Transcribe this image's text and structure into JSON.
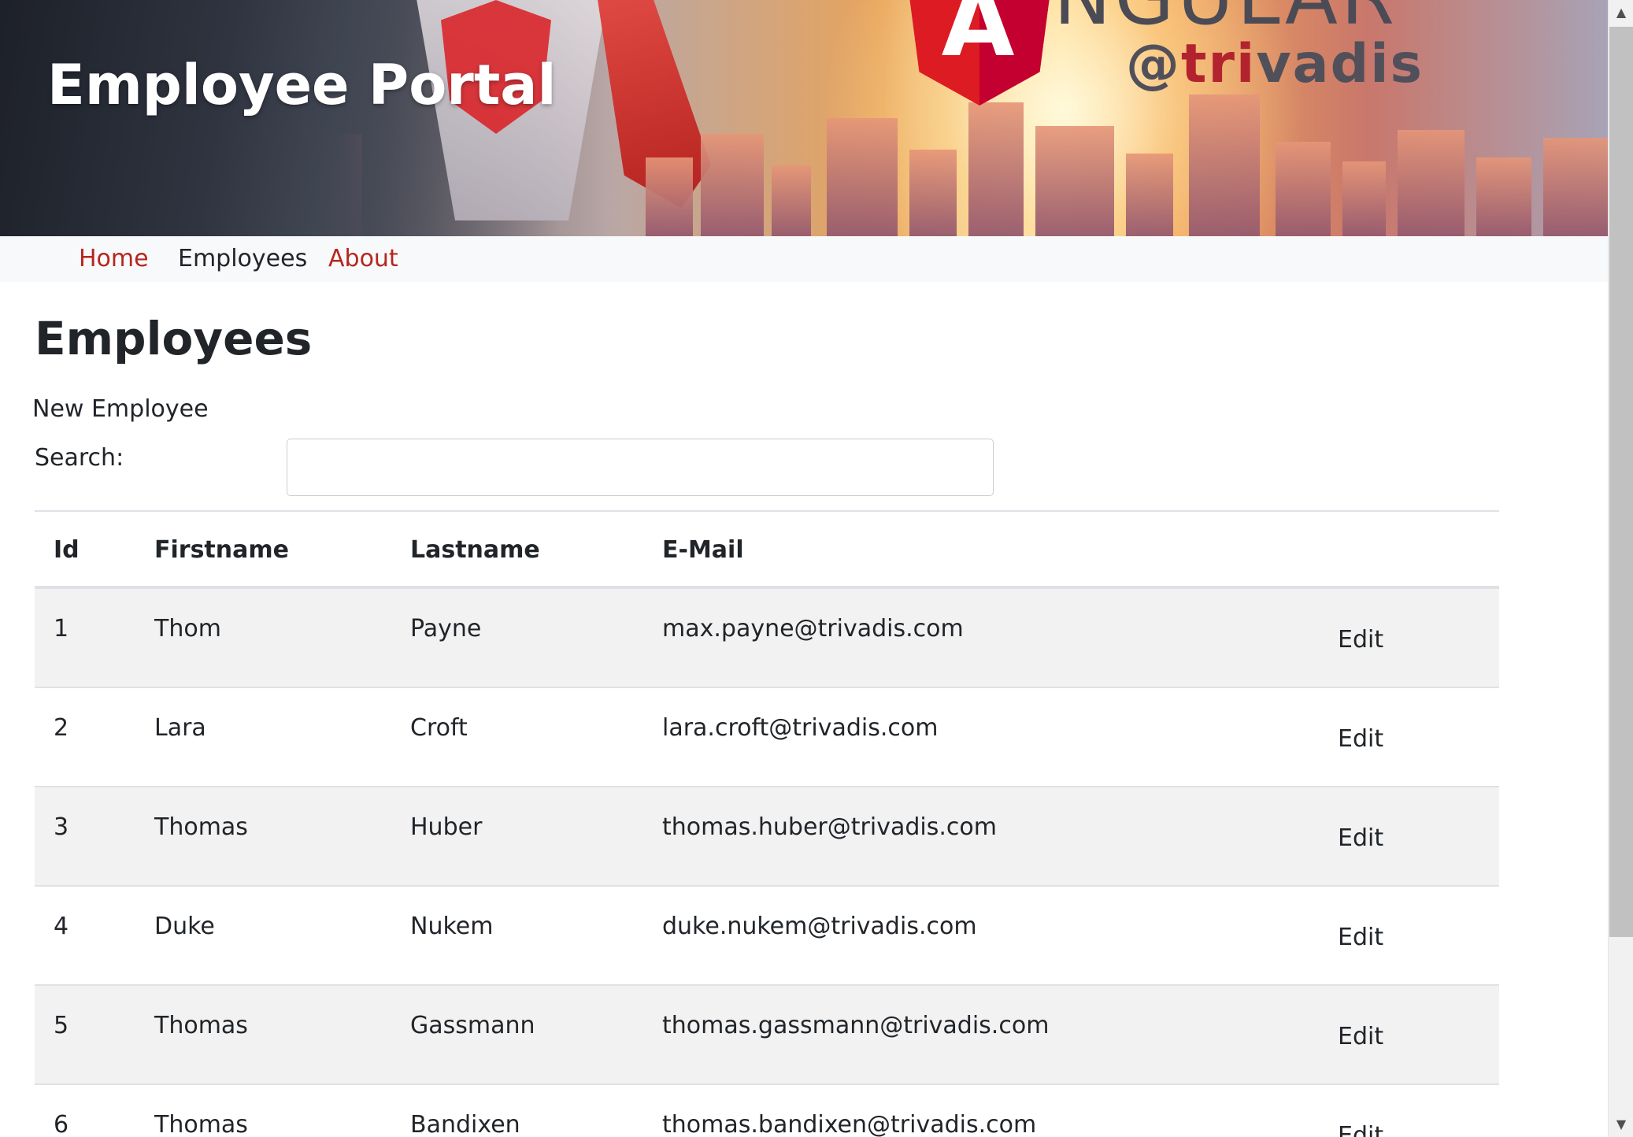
{
  "banner": {
    "title": "Employee Portal",
    "logo_word": "NGULAR",
    "logo_letter": "A",
    "brand_prefix": "@",
    "brand_accent": "tri",
    "brand_suffix": "vadis"
  },
  "nav": {
    "items": [
      {
        "label": "Home",
        "active": false
      },
      {
        "label": "Employees",
        "active": true
      },
      {
        "label": "About",
        "active": false
      }
    ]
  },
  "main": {
    "title": "Employees",
    "new_employee_label": "New Employee",
    "search_label": "Search:",
    "search_value": "",
    "table": {
      "headers": {
        "id": "Id",
        "firstname": "Firstname",
        "lastname": "Lastname",
        "email": "E-Mail"
      },
      "edit_label": "Edit",
      "rows": [
        {
          "id": "1",
          "firstname": "Thom",
          "lastname": "Payne",
          "email": "max.payne@trivadis.com"
        },
        {
          "id": "2",
          "firstname": "Lara",
          "lastname": "Croft",
          "email": "lara.croft@trivadis.com"
        },
        {
          "id": "3",
          "firstname": "Thomas",
          "lastname": "Huber",
          "email": "thomas.huber@trivadis.com"
        },
        {
          "id": "4",
          "firstname": "Duke",
          "lastname": "Nukem",
          "email": "duke.nukem@trivadis.com"
        },
        {
          "id": "5",
          "firstname": "Thomas",
          "lastname": "Gassmann",
          "email": "thomas.gassmann@trivadis.com"
        },
        {
          "id": "6",
          "firstname": "Thomas",
          "lastname": "Bandixen",
          "email": "thomas.bandixen@trivadis.com"
        }
      ]
    }
  },
  "colors": {
    "nav_link": "#b5261f",
    "nav_active": "#212529",
    "nav_background": "#f8f9fa",
    "row_stripe": "#f2f2f2",
    "angular_red": "#dd1b22"
  },
  "icons": {
    "scroll_up": "scroll-up-arrow-icon",
    "scroll_down": "scroll-down-arrow-icon"
  }
}
